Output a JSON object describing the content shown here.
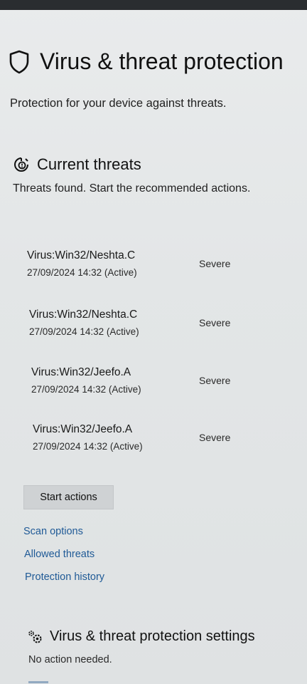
{
  "header": {
    "title": "Virus & threat protection",
    "subtitle": "Protection for your device against threats.",
    "icon": "shield-icon"
  },
  "current_threats": {
    "title": "Current threats",
    "description": "Threats found. Start the recommended actions.",
    "icon": "threat-icon",
    "items": [
      {
        "name": "Virus:Win32/Neshta.C",
        "date": "27/09/2024 14:32 (Active)",
        "severity": "Severe"
      },
      {
        "name": "Virus:Win32/Neshta.C",
        "date": "27/09/2024 14:32 (Active)",
        "severity": "Severe"
      },
      {
        "name": "Virus:Win32/Jeefo.A",
        "date": "27/09/2024 14:32 (Active)",
        "severity": "Severe"
      },
      {
        "name": "Virus:Win32/Jeefo.A",
        "date": "27/09/2024 14:32 (Active)",
        "severity": "Severe"
      }
    ],
    "start_button_label": "Start actions",
    "links": {
      "scan_options": "Scan options",
      "allowed_threats": "Allowed threats",
      "protection_history": "Protection history"
    }
  },
  "settings": {
    "title": "Virus & threat protection settings",
    "description": "No action needed.",
    "icon": "gear-icon"
  },
  "colors": {
    "link": "#1f5a96",
    "button_bg": "#cfd2d4",
    "page_bg": "#e6e8e9"
  }
}
